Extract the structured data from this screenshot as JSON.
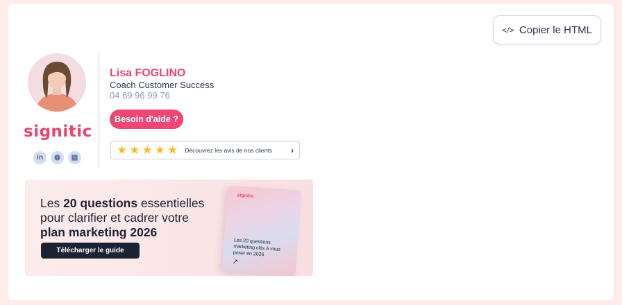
{
  "toolbar": {
    "copy_html_label": "Copier le HTML",
    "copy_icon": "code-icon"
  },
  "signature": {
    "brand": "signitic",
    "name": "Lisa FOGLINO",
    "role": "Coach Customer Success",
    "phone": "04 69 96 99 76",
    "help_label": "Besoin d'aide ?",
    "socials": [
      {
        "icon": "linkedin-icon",
        "glyph": "in"
      },
      {
        "icon": "globe-icon",
        "glyph": "◍"
      },
      {
        "icon": "contact-card-icon",
        "glyph": "▤"
      }
    ],
    "reviews": {
      "stars": 5,
      "label": "Découvrez les avis de nos clients"
    }
  },
  "banner": {
    "line1_pre": "Les ",
    "line1_bold": "20 questions",
    "line1_post": " essentielles",
    "line2": "pour clarifier et cadrer votre",
    "line3_bold": "plan marketing 2026",
    "cta": "Télécharger le guide",
    "book_brand": "signitic",
    "book_title": "Les 20 questions marketing clés à vous poser en 2026",
    "book_arrow": "↗"
  },
  "colors": {
    "accent": "#ef4773",
    "text_dark": "#2b3553",
    "page_bg": "#fdecea",
    "star": "#f5be2b"
  }
}
